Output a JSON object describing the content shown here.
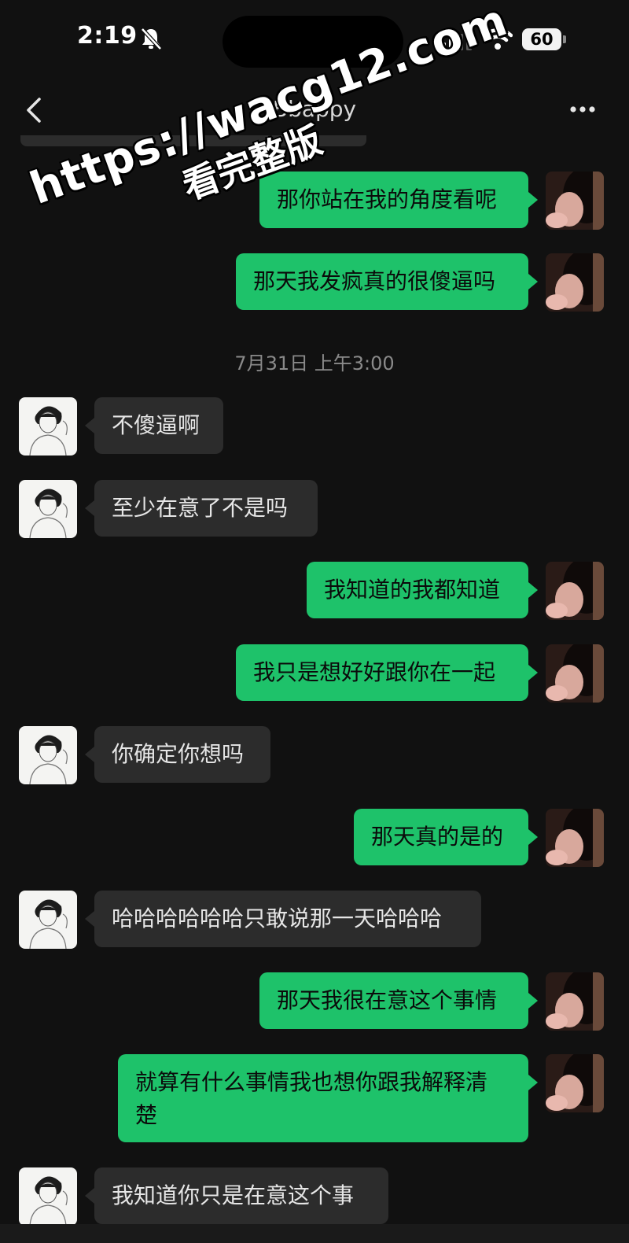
{
  "status_bar": {
    "time": "2:19",
    "battery": "60",
    "icons": [
      "bell-slash-icon",
      "signal-icon",
      "wifi-icon",
      "battery-icon"
    ]
  },
  "nav": {
    "title": "Bbappy",
    "back_icon": "chevron-left-icon",
    "more_icon": "ellipsis-icon"
  },
  "watermark": {
    "line1": "https://wacg12.com",
    "line2": "看完整版"
  },
  "timestamp": "7月31日 上午3:00",
  "colors": {
    "background": "#111111",
    "my_bubble": "#1ec26a",
    "other_bubble": "#2c2c2c",
    "timestamp": "#8a8a8a"
  },
  "messages": [
    {
      "side": "me",
      "text": "那你站在我的角度看呢"
    },
    {
      "side": "me",
      "text": "那天我发疯真的很傻逼吗"
    },
    {
      "side": "other",
      "text": "不傻逼啊"
    },
    {
      "side": "other",
      "text": "至少在意了不是吗"
    },
    {
      "side": "me",
      "text": "我知道的我都知道"
    },
    {
      "side": "me",
      "text": "我只是想好好跟你在一起"
    },
    {
      "side": "other",
      "text": "你确定你想吗"
    },
    {
      "side": "me",
      "text": "那天真的是的"
    },
    {
      "side": "other",
      "text": "哈哈哈哈哈哈只敢说那一天哈哈哈"
    },
    {
      "side": "me",
      "text": "那天我很在意这个事情"
    },
    {
      "side": "me",
      "text": "就算有什么事情我也想你跟我解释清",
      "text2": "楚"
    },
    {
      "side": "other",
      "text": "我知道你只是在意这个事"
    }
  ]
}
